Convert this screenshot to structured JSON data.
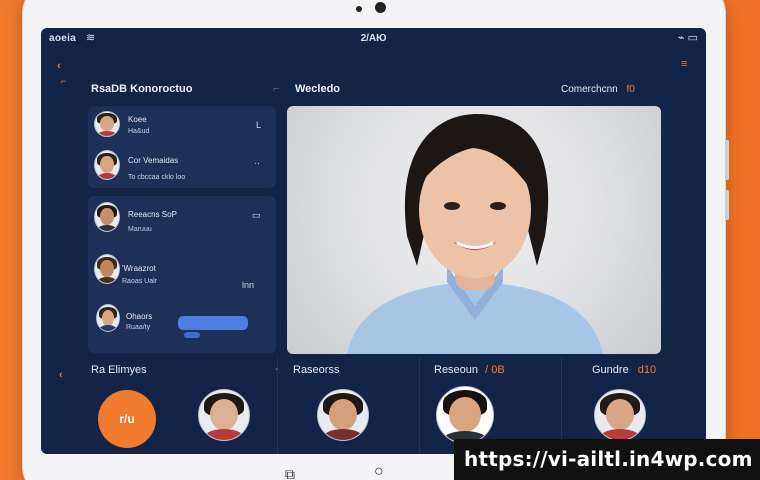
{
  "status_bar": {
    "left": "aoeia",
    "time": "2/АЮ",
    "right": "⌁ ▭"
  },
  "sidebar": {
    "title": "RsaDB Konoroctuo",
    "contacts": [
      {
        "name": "Koee",
        "sub": "Ha&ud",
        "action": "L"
      },
      {
        "name": "Cor Vemaidas",
        "sub": "To cbccaa cklo loo",
        "action": "··"
      },
      {
        "name": "Reeacns SoP",
        "sub": "Maruuu",
        "action": "▭"
      },
      {
        "name": "'Wraazrot",
        "sub": "Raoas Ualr",
        "action": "lnn"
      },
      {
        "name": "Ohaors",
        "sub": "Ruaa/ty",
        "action": ""
      }
    ]
  },
  "main": {
    "video_title": "Wecledo",
    "right_title": "Comerchcnn",
    "right_num": "f0"
  },
  "bottom": {
    "left_label": "Ra Elimyes",
    "call_label": "r/u",
    "mid_label": "Raseorss",
    "mid2_label": "Reseoun",
    "mid2_num": "/ 0B",
    "right_label": "Gundre",
    "right_num": "d10"
  },
  "banner": {
    "url": "https://vi-ailtl.in4wp.com"
  },
  "colors": {
    "accent": "#f07a2e",
    "screen_bg": "#142447",
    "card_bg": "#1d3058",
    "pill": "#4d7ee0"
  },
  "icons": [
    "wifi-icon",
    "battery-icon",
    "menu-icon",
    "settings-icon",
    "phone-icon",
    "home-icon",
    "square-icon"
  ]
}
